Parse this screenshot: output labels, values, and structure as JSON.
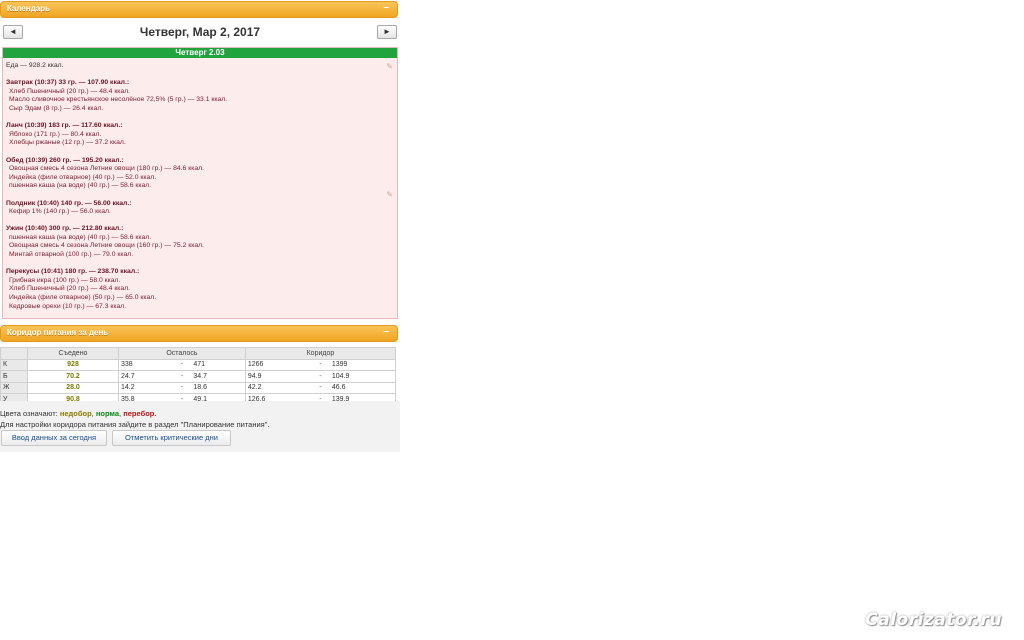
{
  "calendar": {
    "title": "Календарь",
    "toggle": "–",
    "prev": "◄",
    "next": "►",
    "date": "Четверг, Мар 2, 2017",
    "day_label": "Четверг  2.03",
    "edit_icon": "pencil-icon"
  },
  "day_lines": [
    {
      "text": "Еда — 928.2 ккал.",
      "kind": "total"
    },
    {
      "text": "",
      "kind": "blank"
    },
    {
      "text": "Завтрак (10:37) 33 гр. — 107.90 ккал.:",
      "kind": "head"
    },
    {
      "text": "Хлеб Пшеничный (20 гр.) — 48.4 ккал.",
      "kind": "item"
    },
    {
      "text": "Масло сливочное крестьянское несолёное 72,5% (5 гр.) — 33.1 ккал.",
      "kind": "item"
    },
    {
      "text": "Сыр Эдам (8 гр.) — 26.4 ккал.",
      "kind": "item"
    },
    {
      "text": "",
      "kind": "blank"
    },
    {
      "text": "Ланч (10:39) 183 гр. — 117.60 ккал.:",
      "kind": "head"
    },
    {
      "text": "Яблоко (171 гр.) — 80.4 ккал.",
      "kind": "item"
    },
    {
      "text": "Хлебцы ржаные (12 гр.) — 37.2 ккал.",
      "kind": "item"
    },
    {
      "text": "",
      "kind": "blank"
    },
    {
      "text": "Обед (10:39) 260 гр. — 195.20 ккал.:",
      "kind": "head"
    },
    {
      "text": "Овощная смесь 4 сезона Летние овощи (180 гр.) — 84.6 ккал.",
      "kind": "item"
    },
    {
      "text": "Индейка (филе отварное) (40 гр.) — 52.0 ккал.",
      "kind": "item"
    },
    {
      "text": "пшенная каша (на воде) (40 гр.) — 58.6 ккал.",
      "kind": "item"
    },
    {
      "text": "",
      "kind": "blank"
    },
    {
      "text": "Полдник (10:40) 140 гр. — 56.00 ккал.:",
      "kind": "head"
    },
    {
      "text": "Кефир 1% (140 гр.) — 56.0 ккал.",
      "kind": "item"
    },
    {
      "text": "",
      "kind": "blank"
    },
    {
      "text": "Ужин (10:40) 300 гр. — 212.80 ккал.:",
      "kind": "head"
    },
    {
      "text": "пшенная каша (на воде) (40 гр.) — 58.6 ккал.",
      "kind": "item"
    },
    {
      "text": "Овощная смесь 4 сезона Летние овощи (160 гр.) — 75.2 ккал.",
      "kind": "item"
    },
    {
      "text": "Минтай отварной (100 гр.) — 79.0 ккал.",
      "kind": "item"
    },
    {
      "text": "",
      "kind": "blank"
    },
    {
      "text": "Перекусы (10:41) 180 гр. — 238.70 ккал.:",
      "kind": "head"
    },
    {
      "text": "Грибная икра (100 гр.) — 58.0 ккал.",
      "kind": "item"
    },
    {
      "text": "Хлеб Пшеничный (20 гр.) — 48.4 ккал.",
      "kind": "item"
    },
    {
      "text": "Индейка (филе отварное) (50 гр.) — 65.0 ккал.",
      "kind": "item"
    },
    {
      "text": "Кедровые орехи (10 гр.) — 67.3 ккал.",
      "kind": "item"
    }
  ],
  "corridor": {
    "title": "Коридор питания за день",
    "toggle": "–",
    "headers": [
      "Съедено",
      "Осталось",
      "Коридор"
    ],
    "rows": [
      {
        "label": "К",
        "eaten": "928",
        "left_min": "338",
        "dash1": "-",
        "left_max": "471",
        "cor_min": "1266",
        "dash2": "-",
        "cor_max": "1399"
      },
      {
        "label": "Б",
        "eaten": "70.2",
        "left_min": "24.7",
        "dash1": "-",
        "left_max": "34.7",
        "cor_min": "94.9",
        "dash2": "-",
        "cor_max": "104.9"
      },
      {
        "label": "Ж",
        "eaten": "28.0",
        "left_min": "14.2",
        "dash1": "-",
        "left_max": "18.6",
        "cor_min": "42.2",
        "dash2": "-",
        "cor_max": "46.6"
      },
      {
        "label": "У",
        "eaten": "90.8",
        "left_min": "35.8",
        "dash1": "-",
        "left_max": "49.1",
        "cor_min": "126.6",
        "dash2": "-",
        "cor_max": "139.9"
      }
    ],
    "legend_prefix": "Цвета означают:",
    "legend_under": "недобор",
    "legend_norm": "норма",
    "legend_over": "перебор.",
    "hint": "Для настройки коридора питания зайдите в раздел \"Планирование питания\"."
  },
  "buttons": {
    "enter_data": "Ввод данных за сегодня",
    "critical_days": "Отметить критические дни"
  },
  "watermark": "Calorizator.ru",
  "colors": {
    "header": "#f0a520",
    "day_bar": "#21a33e",
    "under": "#8a7a00",
    "norm": "#0a8a1a",
    "over": "#b01818"
  }
}
